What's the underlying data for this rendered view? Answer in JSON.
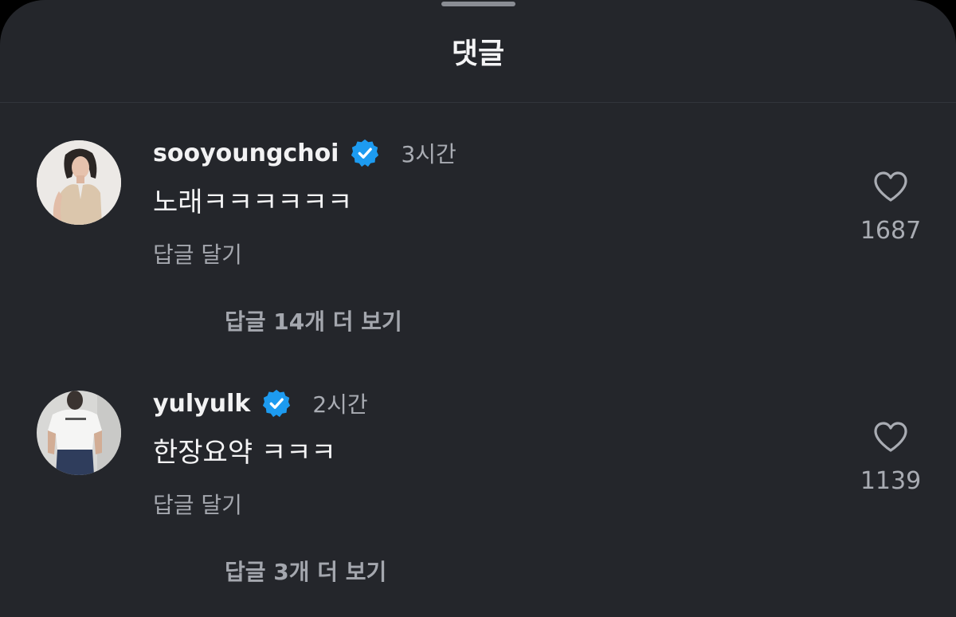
{
  "header": {
    "title": "댓글"
  },
  "comments": [
    {
      "username": "sooyoungchoi",
      "time": "3시간",
      "text": "노래ㅋㅋㅋㅋㅋㅋ",
      "reply_label": "답글 달기",
      "more_replies": "답글 14개 더 보기",
      "likes": "1687"
    },
    {
      "username": "yulyulk",
      "time": "2시간",
      "text": "한장요약 ㅋㅋㅋ",
      "reply_label": "답글 달기",
      "more_replies": "답글 3개 더 보기",
      "likes": "1139"
    }
  ],
  "colors": {
    "background": "#24262b",
    "verified": "#1d9bf0",
    "text_primary": "#f4f4f5",
    "text_secondary": "#a4a7ae"
  },
  "icons": {
    "verified": "verified-badge-icon",
    "like": "heart-outline-icon"
  }
}
